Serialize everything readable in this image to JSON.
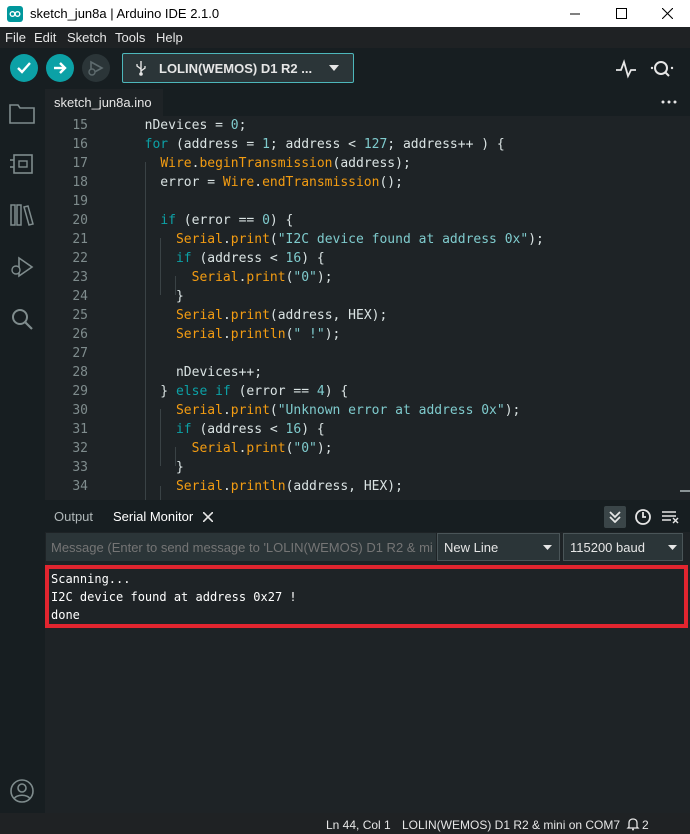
{
  "window": {
    "title": "sketch_jun8a | Arduino IDE 2.1.0"
  },
  "menu": {
    "items": [
      "File",
      "Edit",
      "Sketch",
      "Tools",
      "Help"
    ]
  },
  "toolbar": {
    "board": "LOLIN(WEMOS) D1 R2 ..."
  },
  "tab": {
    "name": "sketch_jun8a.ino"
  },
  "code": [
    {
      "n": "15",
      "t": "  nDevices = 0;"
    },
    {
      "n": "16",
      "t": "  for (address = 1; address < 127; address++ ) {"
    },
    {
      "n": "17",
      "t": "    Wire.beginTransmission(address);"
    },
    {
      "n": "18",
      "t": "    error = Wire.endTransmission();"
    },
    {
      "n": "19",
      "t": ""
    },
    {
      "n": "20",
      "t": "    if (error == 0) {"
    },
    {
      "n": "21",
      "t": "      Serial.print(\"I2C device found at address 0x\");"
    },
    {
      "n": "22",
      "t": "      if (address < 16) {"
    },
    {
      "n": "23",
      "t": "        Serial.print(\"0\");"
    },
    {
      "n": "24",
      "t": "      }"
    },
    {
      "n": "25",
      "t": "      Serial.print(address, HEX);"
    },
    {
      "n": "26",
      "t": "      Serial.println(\" !\");"
    },
    {
      "n": "27",
      "t": ""
    },
    {
      "n": "28",
      "t": "      nDevices++;"
    },
    {
      "n": "29",
      "t": "    } else if (error == 4) {"
    },
    {
      "n": "30",
      "t": "      Serial.print(\"Unknown error at address 0x\");"
    },
    {
      "n": "31",
      "t": "      if (address < 16) {"
    },
    {
      "n": "32",
      "t": "        Serial.print(\"0\");"
    },
    {
      "n": "33",
      "t": "      }"
    },
    {
      "n": "34",
      "t": "      Serial.println(address, HEX);"
    }
  ],
  "panel": {
    "output_tab": "Output",
    "serial_tab": "Serial Monitor"
  },
  "serial": {
    "placeholder": "Message (Enter to send message to 'LOLIN(WEMOS) D1 R2 & mi",
    "line_ending": "New Line",
    "baud": "115200 baud",
    "output": "Scanning...\nI2C device found at address 0x27 !\ndone"
  },
  "status": {
    "position": "Ln 44, Col 1",
    "board_port": "LOLIN(WEMOS) D1 R2 & mini on COM7",
    "notifications": "2"
  },
  "colors": {
    "accent": "#00979c",
    "highlight": "#e2252f"
  }
}
